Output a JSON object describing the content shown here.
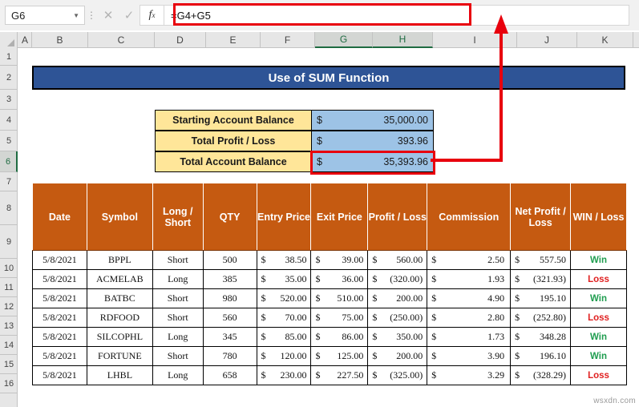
{
  "formula_bar": {
    "name_box_value": "G6",
    "cancel_icon": "close-icon",
    "confirm_icon": "check-icon",
    "fx_label": "fx",
    "formula": "=G4+G5"
  },
  "columns": [
    "A",
    "B",
    "C",
    "D",
    "E",
    "F",
    "G",
    "H",
    "I",
    "J",
    "K"
  ],
  "selected_columns": [
    "G",
    "H"
  ],
  "rows": [
    "1",
    "2",
    "3",
    "4",
    "5",
    "6",
    "7",
    "8",
    "9",
    "10",
    "11",
    "12",
    "13",
    "14",
    "15",
    "16"
  ],
  "selected_row": "6",
  "title_banner": "Use of SUM Function",
  "summary": {
    "rows": [
      {
        "label": "Starting Account Balance",
        "currency": "$",
        "amount": "35,000.00",
        "highlighted": false
      },
      {
        "label": "Total Profit / Loss",
        "currency": "$",
        "amount": "393.96",
        "highlighted": false
      },
      {
        "label": "Total Account Balance",
        "currency": "$",
        "amount": "35,393.96",
        "highlighted": true
      }
    ]
  },
  "table": {
    "headers": [
      "Date",
      "Symbol",
      "Long / Short",
      "QTY",
      "Entry Price",
      "Exit Price",
      "Profit / Loss",
      "Commission",
      "Net Profit / Loss",
      "WIN / Loss"
    ],
    "rows": [
      {
        "date": "5/8/2021",
        "symbol": "BPPL",
        "long_short": "Short",
        "qty": "500",
        "entry_cur": "$",
        "entry": "38.50",
        "exit_cur": "$",
        "exit": "39.00",
        "pl_cur": "$",
        "pl": "560.00",
        "com_cur": "$",
        "commission": "2.50",
        "net_cur": "$",
        "net": "557.50",
        "result": "Win"
      },
      {
        "date": "5/8/2021",
        "symbol": "ACMELAB",
        "long_short": "Long",
        "qty": "385",
        "entry_cur": "$",
        "entry": "35.00",
        "exit_cur": "$",
        "exit": "36.00",
        "pl_cur": "$",
        "pl": "(320.00)",
        "com_cur": "$",
        "commission": "1.93",
        "net_cur": "$",
        "net": "(321.93)",
        "result": "Loss"
      },
      {
        "date": "5/8/2021",
        "symbol": "BATBC",
        "long_short": "Short",
        "qty": "980",
        "entry_cur": "$",
        "entry": "520.00",
        "exit_cur": "$",
        "exit": "510.00",
        "pl_cur": "$",
        "pl": "200.00",
        "com_cur": "$",
        "commission": "4.90",
        "net_cur": "$",
        "net": "195.10",
        "result": "Win"
      },
      {
        "date": "5/8/2021",
        "symbol": "RDFOOD",
        "long_short": "Short",
        "qty": "560",
        "entry_cur": "$",
        "entry": "70.00",
        "exit_cur": "$",
        "exit": "75.00",
        "pl_cur": "$",
        "pl": "(250.00)",
        "com_cur": "$",
        "commission": "2.80",
        "net_cur": "$",
        "net": "(252.80)",
        "result": "Loss"
      },
      {
        "date": "5/8/2021",
        "symbol": "SILCOPHL",
        "long_short": "Long",
        "qty": "345",
        "entry_cur": "$",
        "entry": "85.00",
        "exit_cur": "$",
        "exit": "86.00",
        "pl_cur": "$",
        "pl": "350.00",
        "com_cur": "$",
        "commission": "1.73",
        "net_cur": "$",
        "net": "348.28",
        "result": "Win"
      },
      {
        "date": "5/8/2021",
        "symbol": "FORTUNE",
        "long_short": "Short",
        "qty": "780",
        "entry_cur": "$",
        "entry": "120.00",
        "exit_cur": "$",
        "exit": "125.00",
        "pl_cur": "$",
        "pl": "200.00",
        "com_cur": "$",
        "commission": "3.90",
        "net_cur": "$",
        "net": "196.10",
        "result": "Win"
      },
      {
        "date": "5/8/2021",
        "symbol": "LHBL",
        "long_short": "Long",
        "qty": "658",
        "entry_cur": "$",
        "entry": "230.00",
        "exit_cur": "$",
        "exit": "227.50",
        "pl_cur": "$",
        "pl": "(325.00)",
        "com_cur": "$",
        "commission": "3.29",
        "net_cur": "$",
        "net": "(328.29)",
        "result": "Loss"
      }
    ]
  },
  "annotation": {
    "color": "#e8000d",
    "description": "arrow-from-cell-to-formula-bar"
  },
  "watermark": "wsxdn.com",
  "colors": {
    "banner_blue": "#2e5496",
    "header_orange": "#c55a11",
    "label_yellow": "#ffe699",
    "value_blue": "#9dc3e6",
    "win_green": "#1f9d4f",
    "loss_red": "#e02020",
    "annotation_red": "#e8000d"
  }
}
